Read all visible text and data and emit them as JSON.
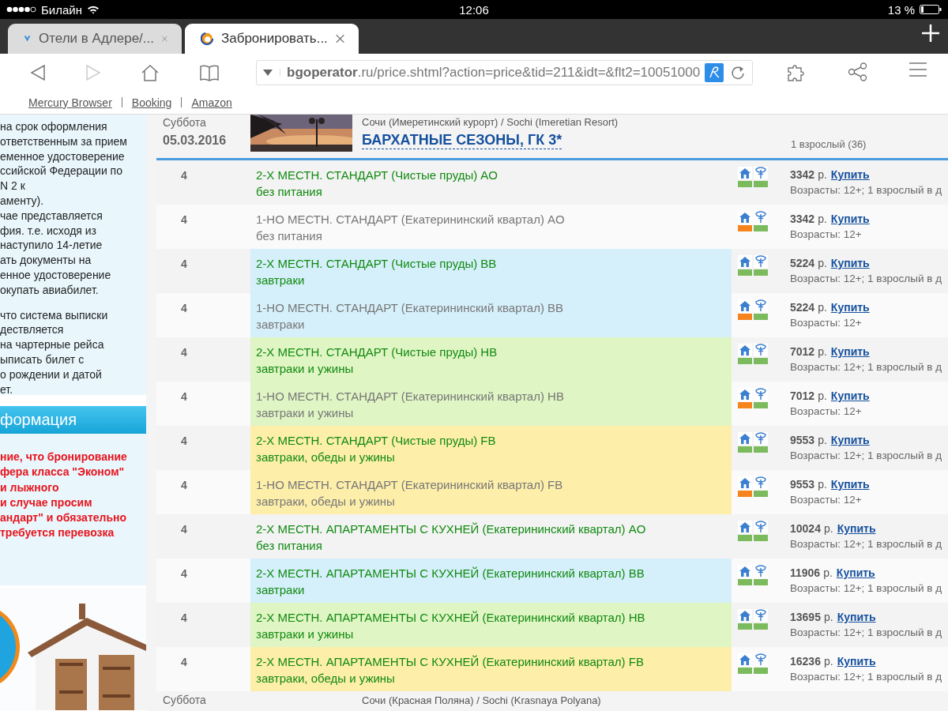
{
  "status_bar": {
    "carrier": "Билайн",
    "time": "12:06",
    "battery": "13 %"
  },
  "tabs": [
    {
      "title": "Отели в Адлере/...",
      "selected": false
    },
    {
      "title": "Забронировать...",
      "selected": true
    }
  ],
  "address_bar": {
    "url": "**bgoperator**.ru/price.shtml?action=price&tid=211&idt=&flt2=10051000"
  },
  "bookmarks": [
    "Mercury Browser",
    "Booking",
    "Amazon"
  ],
  "sidebar": {
    "notes": [
      {
        "lines": [
          "на срок оформления",
          "ответственным за прием",
          "еменное удостоверение",
          "ссийской Федерации по",
          "N 2 к",
          "аменту)."
        ]
      },
      {
        "lines": [
          "чае представляется",
          "фия. т.е.  исходя из",
          "наступило 14-летие",
          "ать документы на",
          "енное удостоверение",
          "окупать авиабилет."
        ]
      },
      {
        "lines": [
          "что система выписки",
          "дествляется",
          "на чартерные рейса",
          "ыписать билет с",
          "о рождении и датой",
          "ет."
        ]
      }
    ],
    "info_heading": "формация",
    "warning_lines": [
      "ние, что бронирование",
      "фера класса \"Эконом\"",
      "и лыжного",
      "и случае просим",
      "андарт\" и обязательно",
      "требуется перевозка"
    ]
  },
  "hotel": {
    "day": "Суббота",
    "date": "05.03.2016",
    "location": "Сочи (Имеретинский курорт) / Sochi (Imeretian Resort)",
    "name": "БАРХАТНЫЕ СЕЗОНЫ, ГК 3*",
    "guests": "1 взрослый (36)"
  },
  "rows": [
    {
      "nights": "4",
      "room": "2-Х МЕСТН. СТАНДАРТ (Чистые пруды) AO",
      "meal": "без питания",
      "color": "#f3f3f3",
      "on_request": false,
      "price": "3342",
      "currency": "р.",
      "buy": "Купить",
      "ages": "Возрасты: 12+; 1 взрослый в д"
    },
    {
      "nights": "4",
      "room": "1-НО МЕСТН. СТАНДАРТ (Екатерининский квартал) AO",
      "meal": "без питания",
      "color": "#fafafa",
      "on_request": true,
      "price": "3342",
      "currency": "р.",
      "buy": "Купить",
      "ages": "Возрасты: 12+"
    },
    {
      "nights": "4",
      "room": "2-Х МЕСТН. СТАНДАРТ (Чистые пруды) BB",
      "meal": "завтраки",
      "color": "#d6f0fb",
      "on_request": false,
      "price": "5224",
      "currency": "р.",
      "buy": "Купить",
      "ages": "Возрасты: 12+; 1 взрослый в д"
    },
    {
      "nights": "4",
      "room": "1-НО МЕСТН. СТАНДАРТ (Екатерининский квартал) BB",
      "meal": "завтраки",
      "color": "#d6f0fb",
      "on_request": true,
      "price": "5224",
      "currency": "р.",
      "buy": "Купить",
      "ages": "Возрасты: 12+"
    },
    {
      "nights": "4",
      "room": "2-Х МЕСТН. СТАНДАРТ (Чистые пруды) HB",
      "meal": "завтраки и ужины",
      "color": "#e0f5c4",
      "on_request": false,
      "price": "7012",
      "currency": "р.",
      "buy": "Купить",
      "ages": "Возрасты: 12+; 1 взрослый в д"
    },
    {
      "nights": "4",
      "room": "1-НО МЕСТН. СТАНДАРТ (Екатерининский квартал) HB",
      "meal": "завтраки и ужины",
      "color": "#e0f5c4",
      "on_request": true,
      "price": "7012",
      "currency": "р.",
      "buy": "Купить",
      "ages": "Возрасты: 12+"
    },
    {
      "nights": "4",
      "room": "2-Х МЕСТН. СТАНДАРТ (Чистые пруды) FB",
      "meal": "завтраки, обеды и ужины",
      "color": "#fdeeaa",
      "on_request": false,
      "price": "9553",
      "currency": "р.",
      "buy": "Купить",
      "ages": "Возрасты: 12+; 1 взрослый в д"
    },
    {
      "nights": "4",
      "room": "1-НО МЕСТН. СТАНДАРТ (Екатерининский квартал) FB",
      "meal": "завтраки, обеды и ужины",
      "color": "#fdeeaa",
      "on_request": true,
      "price": "9553",
      "currency": "р.",
      "buy": "Купить",
      "ages": "Возрасты: 12+"
    },
    {
      "nights": "4",
      "room": "2-Х МЕСТН. АПАРТАМЕНТЫ С КУХНЕЙ (Екатерининский квартал) AO",
      "meal": "без питания",
      "color": "#f3f3f3",
      "on_request": false,
      "price": "10024",
      "currency": "р.",
      "buy": "Купить",
      "ages": "Возрасты: 12+; 1 взрослый в д"
    },
    {
      "nights": "4",
      "room": "2-Х МЕСТН. АПАРТАМЕНТЫ С КУХНЕЙ (Екатерининский квартал) BB",
      "meal": "завтраки",
      "color": "#d6f0fb",
      "on_request": false,
      "price": "11906",
      "currency": "р.",
      "buy": "Купить",
      "ages": "Возрасты: 12+; 1 взрослый в д"
    },
    {
      "nights": "4",
      "room": "2-Х МЕСТН. АПАРТАМЕНТЫ С КУХНЕЙ (Екатерининский квартал) HB",
      "meal": "завтраки и ужины",
      "color": "#e0f5c4",
      "on_request": false,
      "price": "13695",
      "currency": "р.",
      "buy": "Купить",
      "ages": "Возрасты: 12+; 1 взрослый в д"
    },
    {
      "nights": "4",
      "room": "2-Х МЕСТН. АПАРТАМЕНТЫ С КУХНЕЙ (Екатерининский квартал) FB",
      "meal": "завтраки, обеды и ужины",
      "color": "#fdeeaa",
      "on_request": false,
      "price": "16236",
      "currency": "р.",
      "buy": "Купить",
      "ages": "Возрасты: 12+; 1 взрослый в д"
    }
  ],
  "next_hotel": {
    "day": "Суббота",
    "location": "Сочи (Красная Поляна) / Sochi (Krasnaya Polyana)"
  }
}
